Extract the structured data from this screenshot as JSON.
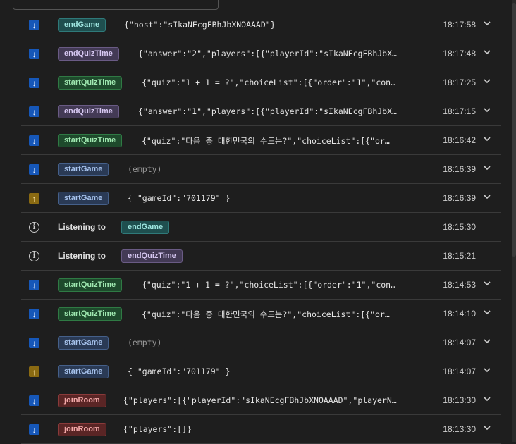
{
  "rows": [
    {
      "kind": "in",
      "badge": "endGame",
      "color": "teal",
      "payload": "{\"host\":\"sIkaNEcgFBhJbXNOAAAD\"}",
      "time": "18:17:58",
      "expand": true
    },
    {
      "kind": "in",
      "badge": "endQuizTime",
      "color": "purple",
      "payload": "{\"answer\":\"2\",\"players\":[{\"playerId\":\"sIkaNEcgFBhJbX…",
      "time": "18:17:48",
      "expand": true
    },
    {
      "kind": "in",
      "badge": "startQuizTime",
      "color": "green",
      "payload": "{\"quiz\":\"1 + 1 = ?\",\"choiceList\":[{\"order\":\"1\",\"con…",
      "time": "18:17:25",
      "expand": true
    },
    {
      "kind": "in",
      "badge": "endQuizTime",
      "color": "purple",
      "payload": "{\"answer\":\"1\",\"players\":[{\"playerId\":\"sIkaNEcgFBhJbX…",
      "time": "18:17:15",
      "expand": true
    },
    {
      "kind": "in",
      "badge": "startQuizTime",
      "color": "green",
      "payload": "{\"quiz\":\"다음 중 대한민국의 수도는?\",\"choiceList\":[{\"or…",
      "time": "18:16:42",
      "expand": true
    },
    {
      "kind": "in",
      "badge": "startGame",
      "color": "blue",
      "payload": "(empty)",
      "muted": true,
      "time": "18:16:39",
      "expand": true
    },
    {
      "kind": "out",
      "badge": "startGame",
      "color": "blue",
      "payload": "{ \"gameId\":\"701179\" }",
      "time": "18:16:39",
      "expand": true
    },
    {
      "kind": "info",
      "label": "Listening to",
      "badge": "endGame",
      "color": "teal",
      "time": "18:15:30",
      "expand": false
    },
    {
      "kind": "info",
      "label": "Listening to",
      "badge": "endQuizTime",
      "color": "purple",
      "time": "18:15:21",
      "expand": false
    },
    {
      "kind": "in",
      "badge": "startQuizTime",
      "color": "green",
      "payload": "{\"quiz\":\"1 + 1 = ?\",\"choiceList\":[{\"order\":\"1\",\"con…",
      "time": "18:14:53",
      "expand": true
    },
    {
      "kind": "in",
      "badge": "startQuizTime",
      "color": "green",
      "payload": "{\"quiz\":\"다음 중 대한민국의 수도는?\",\"choiceList\":[{\"or…",
      "time": "18:14:10",
      "expand": true
    },
    {
      "kind": "in",
      "badge": "startGame",
      "color": "blue",
      "payload": "(empty)",
      "muted": true,
      "time": "18:14:07",
      "expand": true
    },
    {
      "kind": "out",
      "badge": "startGame",
      "color": "blue",
      "payload": "{ \"gameId\":\"701179\" }",
      "time": "18:14:07",
      "expand": true
    },
    {
      "kind": "in",
      "badge": "joinRoom",
      "color": "red",
      "payload": "{\"players\":[{\"playerId\":\"sIkaNEcgFBhJbXNOAAAD\",\"playerN…",
      "time": "18:13:30",
      "expand": true
    },
    {
      "kind": "in",
      "badge": "joinRoom",
      "color": "red",
      "payload": "{\"players\":[]}",
      "time": "18:13:30",
      "expand": true
    }
  ],
  "icons": {
    "incoming": "arrow-down-icon",
    "outgoing": "arrow-up-icon",
    "info": "info-icon",
    "expand": "chevron-down-icon"
  }
}
